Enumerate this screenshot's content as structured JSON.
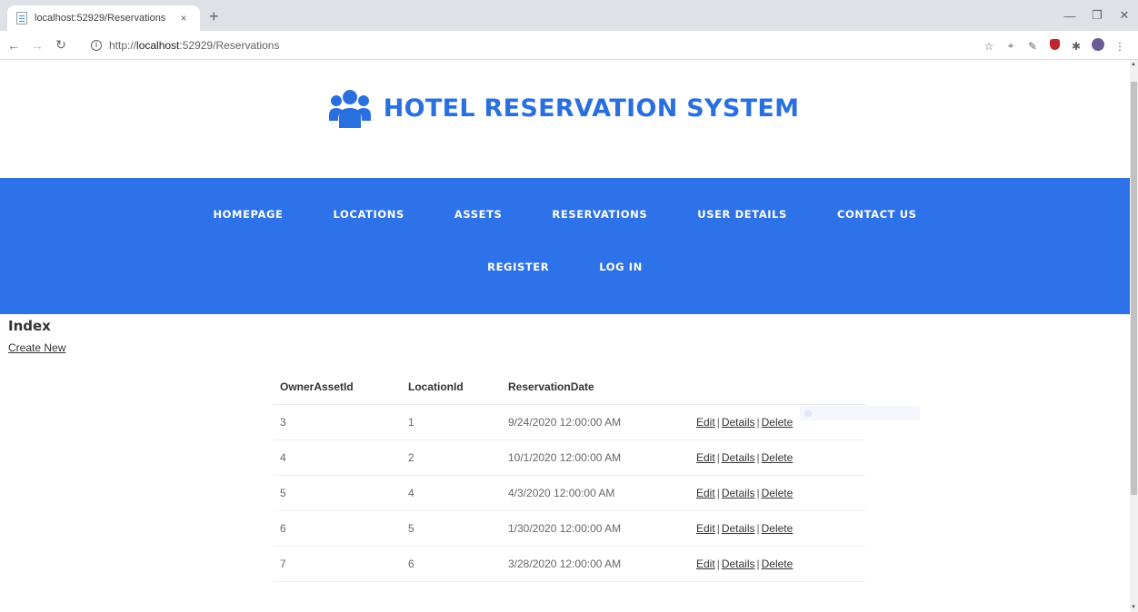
{
  "browser": {
    "tab_title": "localhost:52929/Reservations",
    "tab_close": "×",
    "new_tab": "+",
    "url_prefix": "http://",
    "url_host": "localhost",
    "url_rest": ":52929/Reservations",
    "nav_icons": [
      "back-icon",
      "forward-icon",
      "reload-icon"
    ],
    "extension_icons": [
      "star-icon",
      "cast-icon",
      "eyedropper-icon",
      "ublock-icon",
      "puzzle-icon",
      "profile-icon",
      "menu-icon"
    ]
  },
  "brand": {
    "title": "HOTEL RESERVATION SYSTEM",
    "icon": "users-icon",
    "color": "#2a6fe0"
  },
  "navbar": {
    "color": "#2d72e8",
    "row1": [
      "HOMEPAGE",
      "LOCATIONS",
      "ASSETS",
      "RESERVATIONS",
      "USER DETAILS",
      "CONTACT US"
    ],
    "row2": [
      "REGISTER",
      "LOG IN"
    ]
  },
  "page": {
    "title": "Index",
    "create_link": "Create New"
  },
  "table": {
    "headers": [
      "OwnerAssetId",
      "LocationId",
      "ReservationDate"
    ],
    "rows": [
      {
        "owner": "3",
        "location": "1",
        "date": "9/24/2020 12:00:00 AM"
      },
      {
        "owner": "4",
        "location": "2",
        "date": "10/1/2020 12:00:00 AM"
      },
      {
        "owner": "5",
        "location": "4",
        "date": "4/3/2020 12:00:00 AM"
      },
      {
        "owner": "6",
        "location": "5",
        "date": "1/30/2020 12:00:00 AM"
      },
      {
        "owner": "7",
        "location": "6",
        "date": "3/28/2020 12:00:00 AM"
      }
    ],
    "actions": {
      "edit": "Edit",
      "details": "Details",
      "delete": "Delete",
      "separator": "|"
    }
  }
}
